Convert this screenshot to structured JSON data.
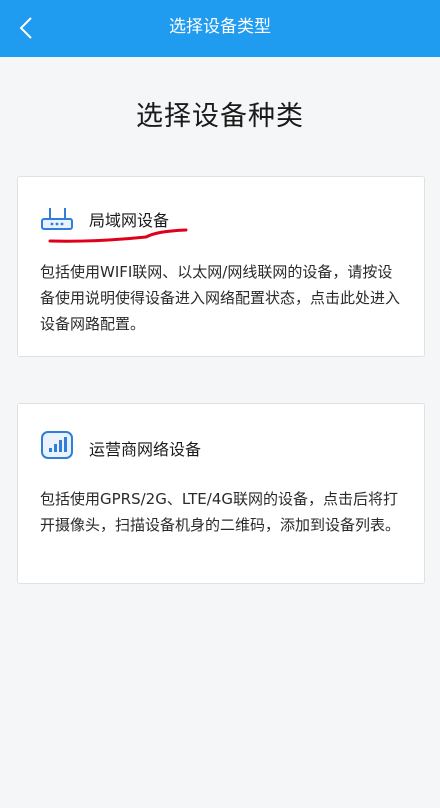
{
  "header": {
    "back_icon": "chevron-left-icon",
    "title": "选择设备类型",
    "color": "#1f9bf0"
  },
  "main": {
    "heading": "选择设备种类",
    "options": [
      {
        "icon": "router-icon",
        "name": "局域网设备",
        "description": "包括使用WIFI联网、以太网/网线联网的设备，请按设备使用说明使得设备进入网络配置状态，点击此处进入设备网路配置。"
      },
      {
        "icon": "cellular-signal-icon",
        "name": "运营商网络设备",
        "description": "包括使用GPRS/2G、LTE/4G联网的设备，点击后将打开摄像头，扫描设备机身的二维码，添加到设备列表。"
      }
    ]
  },
  "annotation": {
    "underline_color": "#e0001a"
  }
}
